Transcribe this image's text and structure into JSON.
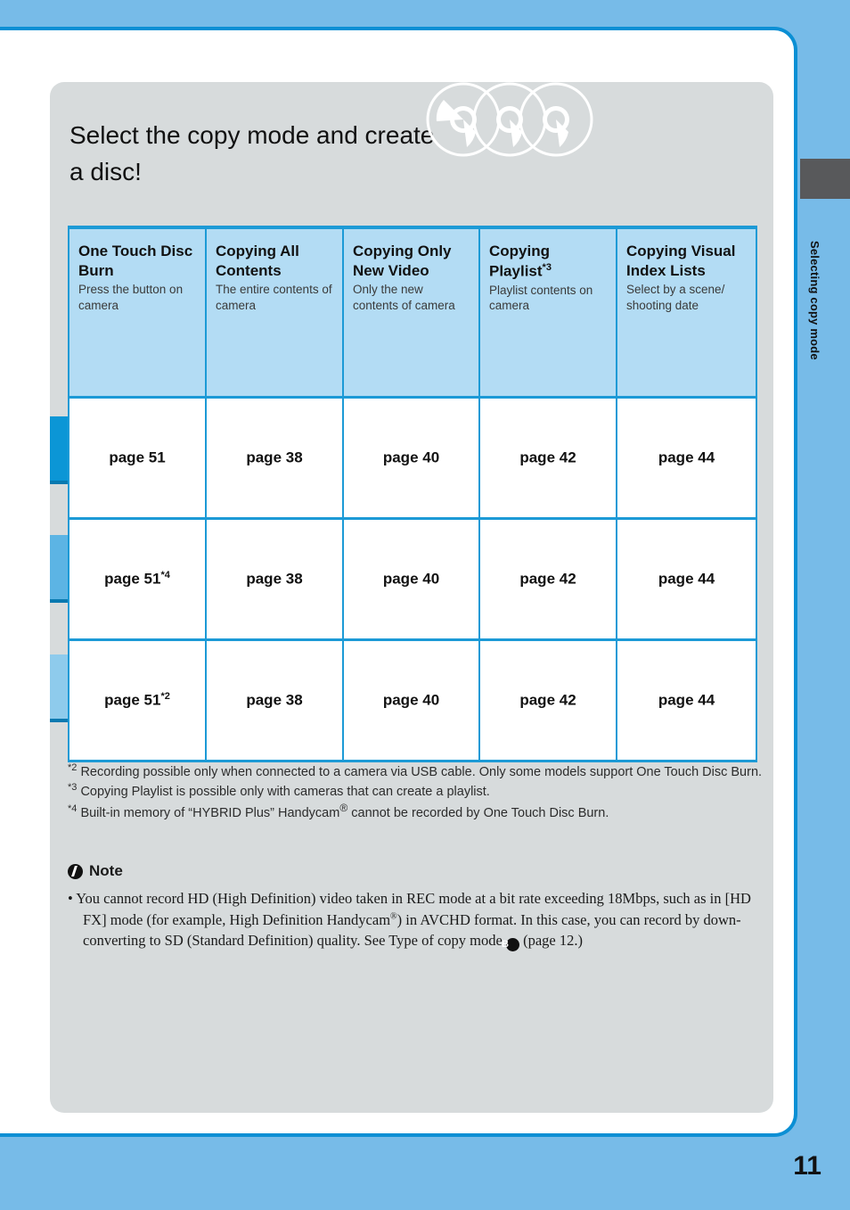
{
  "page": {
    "number": "11",
    "side_tab_label": "Selecting copy mode",
    "headline": "Select the copy mode and create a disc!",
    "decoration_icon": "three-overlapping-discs-icon"
  },
  "table": {
    "columns": [
      {
        "title": "One Touch Disc Burn",
        "subtitle": "Press the button on camera"
      },
      {
        "title": "Copying All Contents",
        "subtitle": "The entire contents of camera"
      },
      {
        "title": "Copying Only New Video",
        "subtitle": "Only the new contents of camera"
      },
      {
        "title": "Copying Playlist",
        "title_sup": "*3",
        "subtitle": "Playlist contents on camera"
      },
      {
        "title": "Copying Visual Index Lists",
        "subtitle": "Select by a scene/ shooting date"
      }
    ],
    "rows": [
      {
        "arrow_name": "arrow-row-1",
        "arrow_color": "#0b96d6",
        "cells": [
          {
            "text": "page 51",
            "sup": ""
          },
          {
            "text": "page 38",
            "sup": ""
          },
          {
            "text": "page 40",
            "sup": ""
          },
          {
            "text": "page 42",
            "sup": ""
          },
          {
            "text": "page 44",
            "sup": ""
          }
        ]
      },
      {
        "arrow_name": "arrow-row-2",
        "arrow_color": "#5cb4e4",
        "cells": [
          {
            "text": "page 51",
            "sup": "*4"
          },
          {
            "text": "page 38",
            "sup": ""
          },
          {
            "text": "page 40",
            "sup": ""
          },
          {
            "text": "page 42",
            "sup": ""
          },
          {
            "text": "page 44",
            "sup": ""
          }
        ]
      },
      {
        "arrow_name": "arrow-row-3",
        "arrow_color": "#8ecbec",
        "cells": [
          {
            "text": "page 51",
            "sup": "*2"
          },
          {
            "text": "page 38",
            "sup": ""
          },
          {
            "text": "page 40",
            "sup": ""
          },
          {
            "text": "page 42",
            "sup": ""
          },
          {
            "text": "page 44",
            "sup": ""
          }
        ]
      }
    ]
  },
  "footnotes": [
    {
      "mark": "*2",
      "text": "Recording possible only when connected to a camera via USB cable. Only some models support One Touch Disc Burn."
    },
    {
      "mark": "*3",
      "text": "Copying Playlist is possible only with cameras that can create a playlist."
    },
    {
      "mark": "*4",
      "text_before": "Built-in memory of “HYBRID Plus” Handycam",
      "registered": "®",
      "text_after": " cannot be recorded by One Touch Disc Burn."
    }
  ],
  "note": {
    "heading": "Note",
    "badge_icon": "note-exclamation-icon",
    "bullet": "•",
    "body_1": "You cannot record HD (High Definition) video taken in REC mode at a bit rate exceeding 18Mbps, such as in [HD FX] mode (for example, High Definition Handycam",
    "registered": "®",
    "body_2": ") in AVCHD format. In this case, you can record by down-converting to SD (Standard Definition) quality. See Type of copy mode ",
    "mode_badge": "B",
    "body_3": " (page 12.)"
  },
  "colors": {
    "page_background": "#77bbe8",
    "frame_border": "#0b8fd4",
    "content_card": "#d7dbdc",
    "table_border": "#1c9ad6",
    "header_fill": "#b3dcf4",
    "side_tab": "#58595b"
  }
}
